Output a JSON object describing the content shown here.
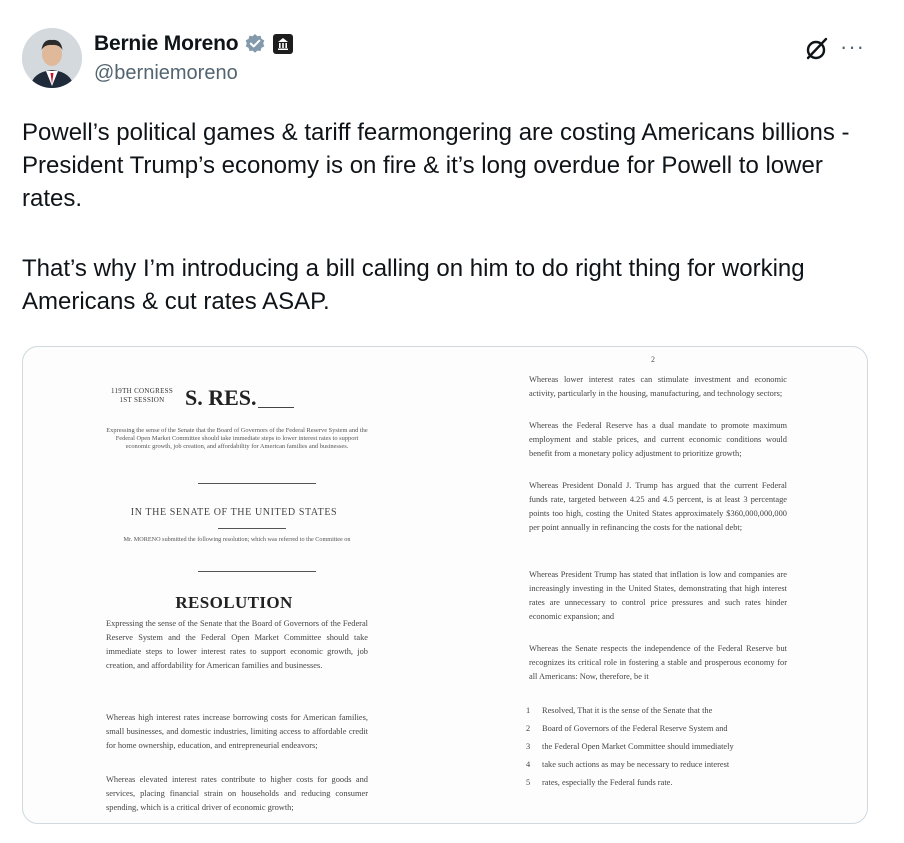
{
  "author": {
    "display_name": "Bernie Moreno",
    "handle": "@berniemoreno"
  },
  "icons": {
    "verified": "verified-badge-icon",
    "affiliation": "government-building-icon",
    "grok": "grok-icon",
    "more": "more-options-icon"
  },
  "colors": {
    "verified_gray": "#829aab",
    "text": "#0f1419",
    "secondary": "#536471",
    "border": "#cfd9de"
  },
  "tweet": {
    "paragraph1": "Powell’s political games & tariff fearmongering are costing Americans billions - President Trump’s economy is on fire & it’s long overdue for Powell to lower rates.",
    "paragraph2": "That’s why I’m introducing a bill calling on him to do right thing for working Americans & cut rates ASAP."
  },
  "more_label": "···",
  "document": {
    "page1": {
      "congress": "119TH CONGRESS",
      "session": "1ST SESSION",
      "title": "S. RES.",
      "summary": "Expressing the sense of the Senate that the Board of Governors of the Federal Reserve System and the Federal Open Market Committee should take immediate steps to lower interest rates to support economic growth, job creation, and affordability for American families and businesses.",
      "senate": "IN THE SENATE OF THE UNITED STATES",
      "submitted": "Mr. MORENO submitted the following resolution; which was referred to the Committee on",
      "resolution": "RESOLUTION",
      "expressing": "Expressing the sense of the Senate that the Board of Governors of the Federal Reserve System and the Federal Open Market Committee should take immediate steps to lower interest rates to support economic growth, job creation, and affordability for American families and businesses.",
      "whereas1": "Whereas high interest rates increase borrowing costs for American families, small businesses, and domestic industries, limiting access to affordable credit for home ownership, education, and entrepreneurial endeavors;",
      "whereas2": "Whereas elevated interest rates contribute to higher costs for goods and services, placing financial strain on households and reducing consumer spending, which is a critical driver of economic growth;"
    },
    "page2": {
      "page_number": "2",
      "whereas1": "Whereas lower interest rates can stimulate investment and economic activity, particularly in the housing, manufacturing, and technology sectors;",
      "whereas2": "Whereas the Federal Reserve has a dual mandate to promote maximum employment and stable prices, and current economic conditions would benefit from a monetary policy adjustment to prioritize growth;",
      "whereas3": "Whereas President Donald J. Trump has argued that the current Federal funds rate, targeted between 4.25 and 4.5 percent, is at least 3 percentage points too high, costing the United States approximately $360,000,000,000 per point annually in refinancing the costs for the national debt;",
      "whereas4": "Whereas President Trump has stated that inflation is low and companies are increasingly investing in the United States, demonstrating that high interest rates are unnecessary to control price pressures and such rates hinder economic expansion; and",
      "whereas5": "Whereas the Senate respects the independence of the Federal Reserve but recognizes its critical role in fostering a stable and prosperous economy for all Americans: Now, therefore, be it",
      "lines": [
        {
          "n": "1",
          "t": "Resolved, That it is the sense of the Senate that the"
        },
        {
          "n": "2",
          "t": "Board of Governors of the Federal Reserve System and"
        },
        {
          "n": "3",
          "t": "the Federal Open Market Committee should immediately"
        },
        {
          "n": "4",
          "t": "take such actions as may be necessary to reduce interest"
        },
        {
          "n": "5",
          "t": "rates, especially the Federal funds rate."
        }
      ]
    }
  }
}
